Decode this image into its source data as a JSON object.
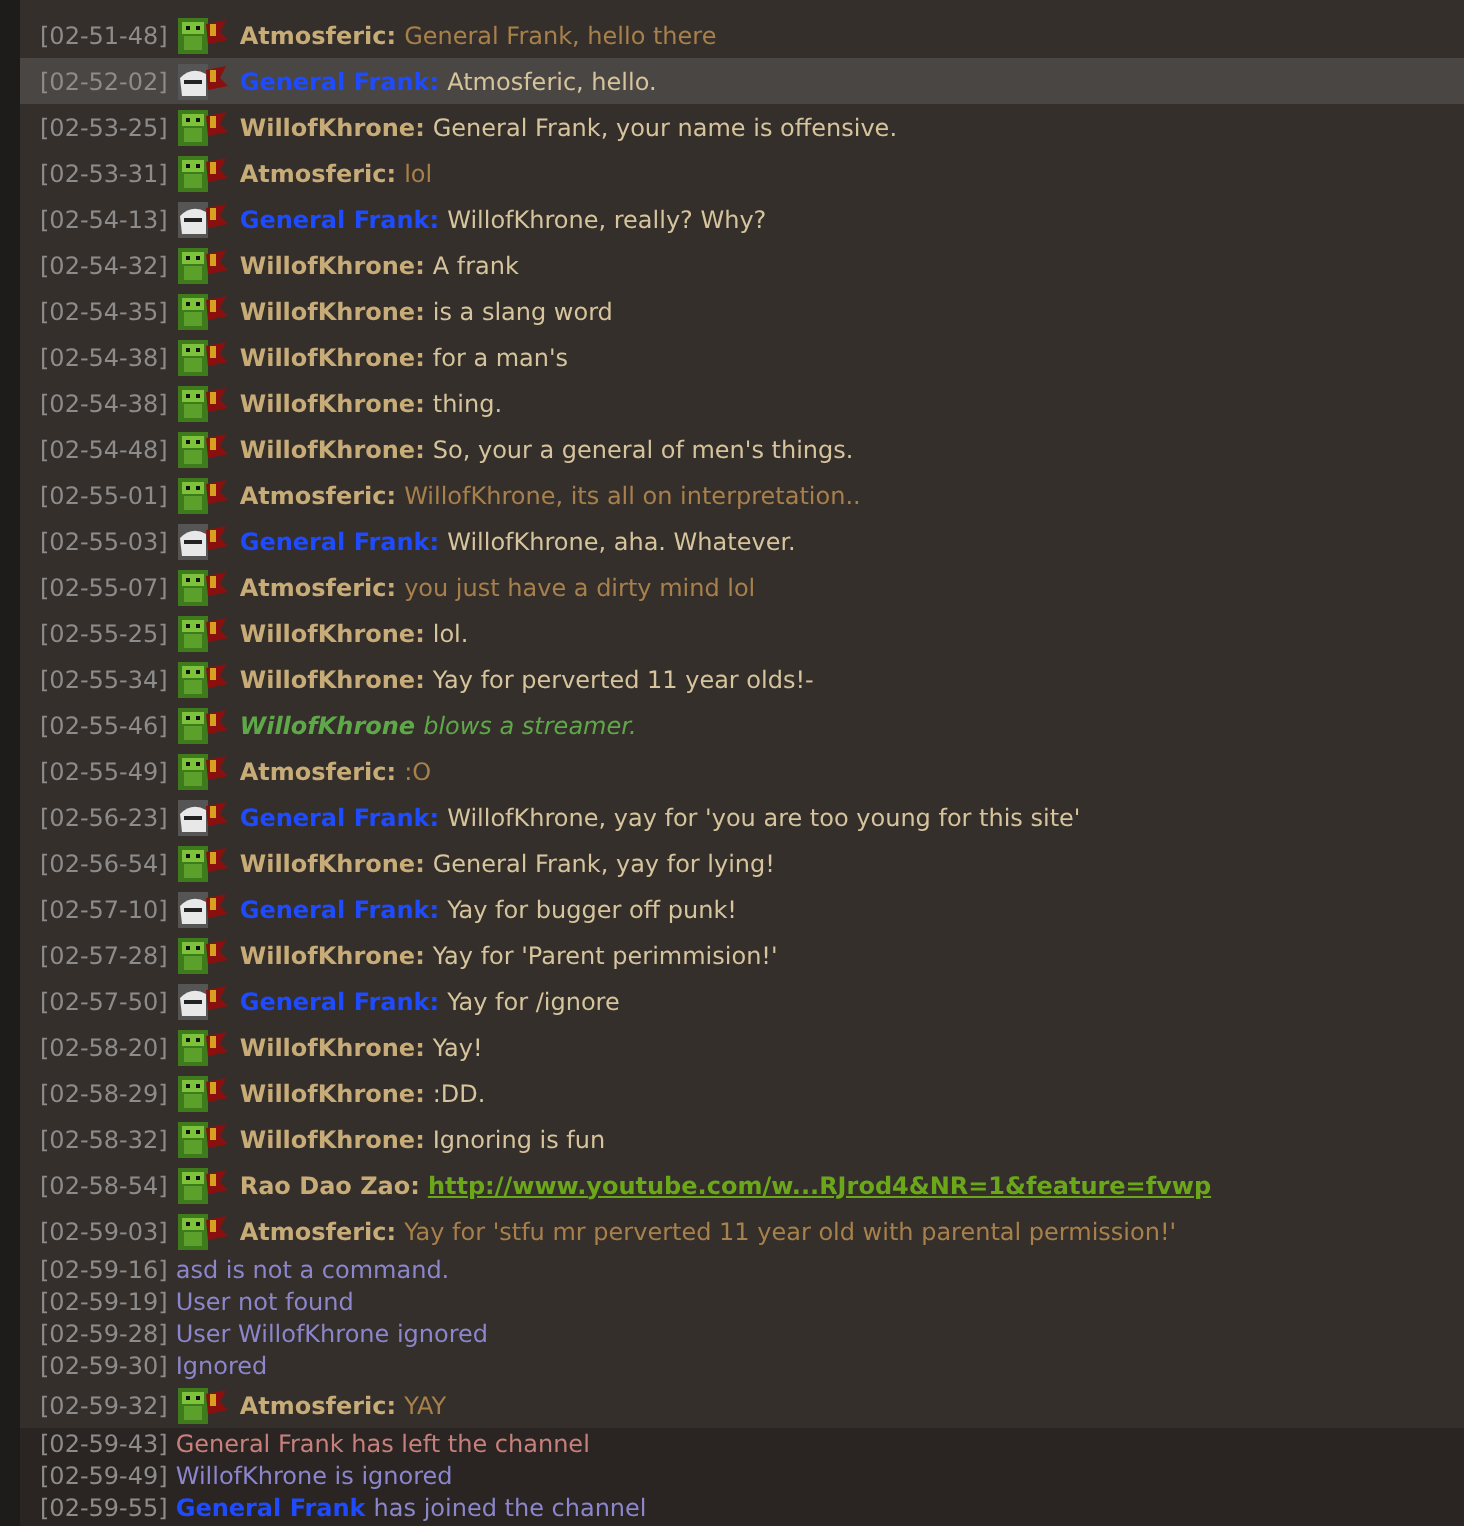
{
  "messages": [
    {
      "kind": "chat",
      "time": "[02-51-48]",
      "author": {
        "kind": "orc",
        "name": "Atmosferic:",
        "color": "#c8ac78"
      },
      "text": "General Frank, hello there",
      "color": "#a8804c",
      "selected": false
    },
    {
      "kind": "chat",
      "time": "[02-52-02]",
      "author": {
        "kind": "human",
        "name": "General Frank:",
        "color": "#1f4bff"
      },
      "text": "Atmosferic, hello.",
      "color": "#d6c49c",
      "selected": true
    },
    {
      "kind": "chat",
      "time": "[02-53-25]",
      "author": {
        "kind": "orc",
        "name": "WillofKhrone:",
        "color": "#c8ac78"
      },
      "text": "General Frank, your name is offensive.",
      "color": "#d6c49c",
      "selected": false
    },
    {
      "kind": "chat",
      "time": "[02-53-31]",
      "author": {
        "kind": "orc",
        "name": "Atmosferic:",
        "color": "#c8ac78"
      },
      "text": "lol",
      "color": "#a8804c",
      "selected": false
    },
    {
      "kind": "chat",
      "time": "[02-54-13]",
      "author": {
        "kind": "human",
        "name": "General Frank:",
        "color": "#1f4bff"
      },
      "text": "WillofKhrone, really? Why?",
      "color": "#d6c49c",
      "selected": false
    },
    {
      "kind": "chat",
      "time": "[02-54-32]",
      "author": {
        "kind": "orc",
        "name": "WillofKhrone:",
        "color": "#c8ac78"
      },
      "text": "A frank",
      "color": "#d6c49c",
      "selected": false
    },
    {
      "kind": "chat",
      "time": "[02-54-35]",
      "author": {
        "kind": "orc",
        "name": "WillofKhrone:",
        "color": "#c8ac78"
      },
      "text": "is a slang word",
      "color": "#d6c49c",
      "selected": false
    },
    {
      "kind": "chat",
      "time": "[02-54-38]",
      "author": {
        "kind": "orc",
        "name": "WillofKhrone:",
        "color": "#c8ac78"
      },
      "text": "for a man's",
      "color": "#d6c49c",
      "selected": false
    },
    {
      "kind": "chat",
      "time": "[02-54-38]",
      "author": {
        "kind": "orc",
        "name": "WillofKhrone:",
        "color": "#c8ac78"
      },
      "text": "thing.",
      "color": "#d6c49c",
      "selected": false
    },
    {
      "kind": "chat",
      "time": "[02-54-48]",
      "author": {
        "kind": "orc",
        "name": "WillofKhrone:",
        "color": "#c8ac78"
      },
      "text": "So, your a general of men's things.",
      "color": "#d6c49c",
      "selected": false
    },
    {
      "kind": "chat",
      "time": "[02-55-01]",
      "author": {
        "kind": "orc",
        "name": "Atmosferic:",
        "color": "#c8ac78"
      },
      "text": "WillofKhrone, its all on interpretation..",
      "color": "#a8804c",
      "selected": false
    },
    {
      "kind": "chat",
      "time": "[02-55-03]",
      "author": {
        "kind": "human",
        "name": "General Frank:",
        "color": "#1f4bff"
      },
      "text": "WillofKhrone, aha. Whatever.",
      "color": "#d6c49c",
      "selected": false
    },
    {
      "kind": "chat",
      "time": "[02-55-07]",
      "author": {
        "kind": "orc",
        "name": "Atmosferic:",
        "color": "#c8ac78"
      },
      "text": "you just have a dirty mind lol",
      "color": "#a8804c",
      "selected": false
    },
    {
      "kind": "chat",
      "time": "[02-55-25]",
      "author": {
        "kind": "orc",
        "name": "WillofKhrone:",
        "color": "#c8ac78"
      },
      "text": "lol.",
      "color": "#d6c49c",
      "selected": false
    },
    {
      "kind": "chat",
      "time": "[02-55-34]",
      "author": {
        "kind": "orc",
        "name": "WillofKhrone:",
        "color": "#c8ac78"
      },
      "text": "Yay for perverted 11 year olds!-",
      "color": "#d6c49c",
      "selected": false
    },
    {
      "kind": "emote",
      "time": "[02-55-46]",
      "author": {
        "kind": "orc",
        "name": "WillofKhrone",
        "color": "#5fa84a"
      },
      "text": "blows a streamer.",
      "color": "#5fa84a",
      "selected": false
    },
    {
      "kind": "chat",
      "time": "[02-55-49]",
      "author": {
        "kind": "orc",
        "name": "Atmosferic:",
        "color": "#c8ac78"
      },
      "text": ":O",
      "color": "#a8804c",
      "selected": false
    },
    {
      "kind": "chat",
      "time": "[02-56-23]",
      "author": {
        "kind": "human",
        "name": "General Frank:",
        "color": "#1f4bff"
      },
      "text": "WillofKhrone, yay for 'you are too young for this site'",
      "color": "#d6c49c",
      "selected": false
    },
    {
      "kind": "chat",
      "time": "[02-56-54]",
      "author": {
        "kind": "orc",
        "name": "WillofKhrone:",
        "color": "#c8ac78"
      },
      "text": "General Frank, yay for lying!",
      "color": "#d6c49c",
      "selected": false
    },
    {
      "kind": "chat",
      "time": "[02-57-10]",
      "author": {
        "kind": "human",
        "name": "General Frank:",
        "color": "#1f4bff"
      },
      "text": "Yay for bugger off punk!",
      "color": "#d6c49c",
      "selected": false
    },
    {
      "kind": "chat",
      "time": "[02-57-28]",
      "author": {
        "kind": "orc",
        "name": "WillofKhrone:",
        "color": "#c8ac78"
      },
      "text": "Yay for 'Parent perimmision!'",
      "color": "#d6c49c",
      "selected": false
    },
    {
      "kind": "chat",
      "time": "[02-57-50]",
      "author": {
        "kind": "human",
        "name": "General Frank:",
        "color": "#1f4bff"
      },
      "text": "Yay for /ignore",
      "color": "#d6c49c",
      "selected": false
    },
    {
      "kind": "chat",
      "time": "[02-58-20]",
      "author": {
        "kind": "orc",
        "name": "WillofKhrone:",
        "color": "#c8ac78"
      },
      "text": "Yay!",
      "color": "#d6c49c",
      "selected": false
    },
    {
      "kind": "chat",
      "time": "[02-58-29]",
      "author": {
        "kind": "orc",
        "name": "WillofKhrone:",
        "color": "#c8ac78"
      },
      "text": ":DD.",
      "color": "#d6c49c",
      "selected": false
    },
    {
      "kind": "chat",
      "time": "[02-58-32]",
      "author": {
        "kind": "orc",
        "name": "WillofKhrone:",
        "color": "#c8ac78"
      },
      "text": "Ignoring is fun",
      "color": "#d6c49c",
      "selected": false
    },
    {
      "kind": "link",
      "time": "[02-58-54]",
      "author": {
        "kind": "orc",
        "name": "Rao Dao Zao:",
        "color": "#c8ac78"
      },
      "text": "http://www.youtube.com/w...RJrod4&NR=1&feature=fvwp",
      "color": "#6aa81a",
      "selected": false
    },
    {
      "kind": "chat",
      "time": "[02-59-03]",
      "author": {
        "kind": "orc",
        "name": "Atmosferic:",
        "color": "#c8ac78"
      },
      "text": "Yay for 'stfu mr perverted 11 year old with parental permission!'",
      "color": "#a8804c",
      "selected": false
    },
    {
      "kind": "system",
      "time": "[02-59-16]",
      "text": "asd is not a command.",
      "color": "#8c86cc",
      "selected": false
    },
    {
      "kind": "system",
      "time": "[02-59-19]",
      "text": "User not found",
      "color": "#8c86cc",
      "selected": false
    },
    {
      "kind": "system",
      "time": "[02-59-28]",
      "text": "User WillofKhrone ignored",
      "color": "#8c86cc",
      "selected": false
    },
    {
      "kind": "system",
      "time": "[02-59-30]",
      "text": "Ignored",
      "color": "#8c86cc",
      "selected": false
    },
    {
      "kind": "chat",
      "time": "[02-59-32]",
      "author": {
        "kind": "orc",
        "name": "Atmosferic:",
        "color": "#c8ac78"
      },
      "text": "YAY",
      "color": "#a8804c",
      "selected": false
    }
  ],
  "recent_messages": [
    {
      "kind": "system",
      "time": "[02-59-43]",
      "text": "General Frank has left the channel",
      "color": "#c8807c",
      "selected": false
    },
    {
      "kind": "system",
      "time": "[02-59-49]",
      "text": "WillofKhrone is ignored",
      "color": "#8c86cc",
      "selected": false
    },
    {
      "kind": "join",
      "time": "[02-59-55]",
      "author": {
        "name": "General Frank",
        "color": "#1f4bff"
      },
      "text": "has joined the channel",
      "color": "#8c86cc",
      "selected": false
    }
  ]
}
